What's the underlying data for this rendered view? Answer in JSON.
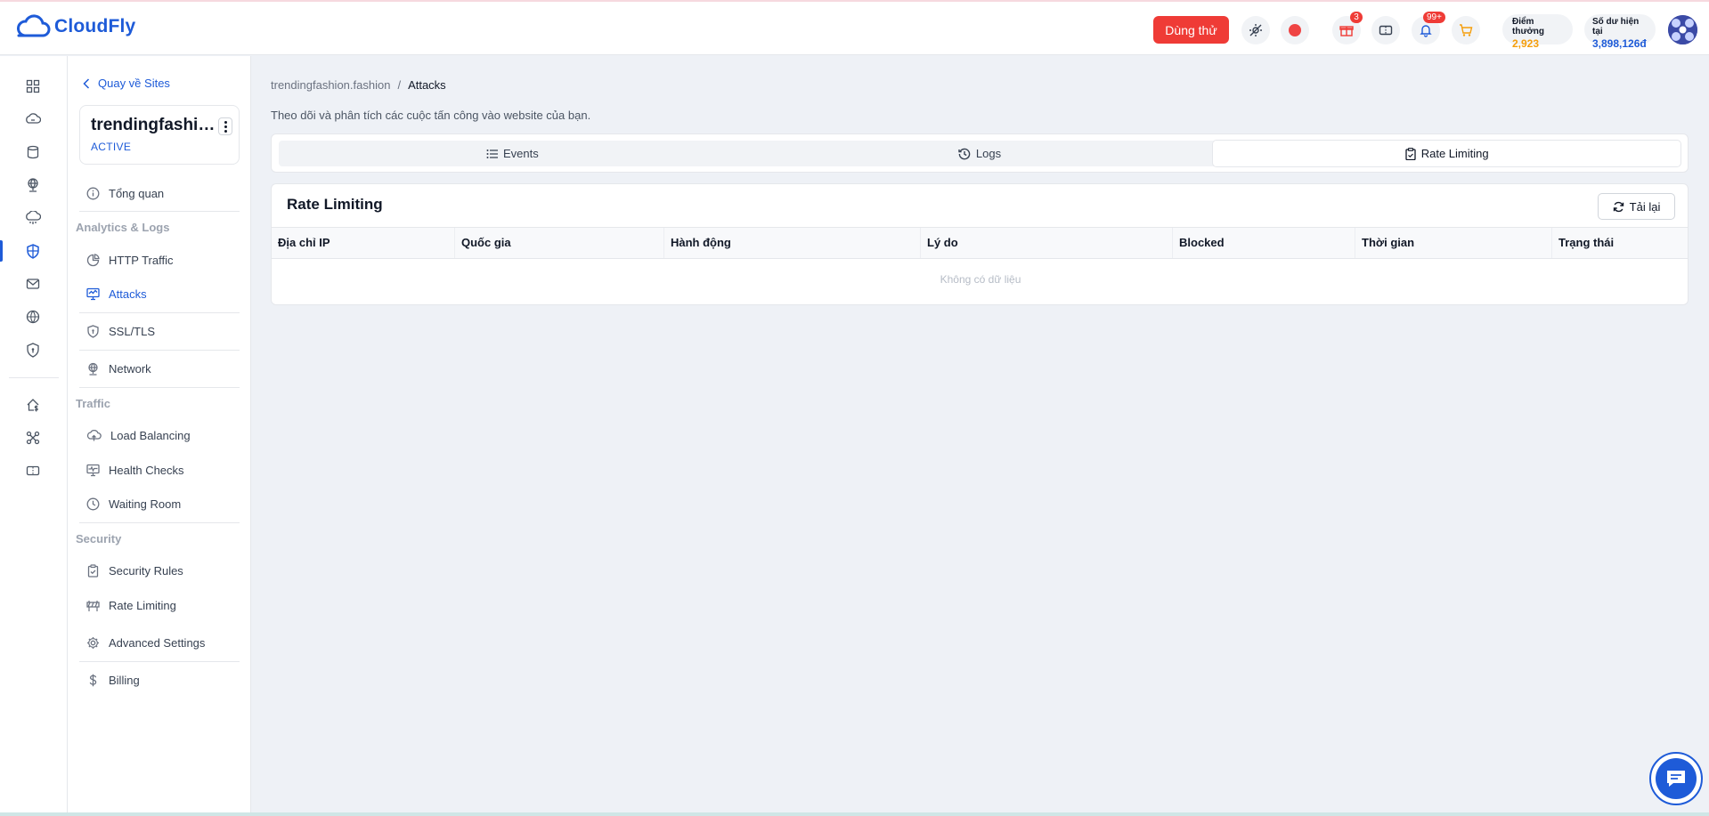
{
  "header": {
    "logo_text": "CloudFly",
    "trial_label": "Dùng thử",
    "gift_badge": "3",
    "notification_badge": "99+",
    "reward_label": "Điểm thưởng",
    "reward_value": "2,923",
    "balance_label": "Số dư hiện tại",
    "balance_value": "3,898,126đ",
    "colors": {
      "brand": "#1e5bd8",
      "trial": "#ef3b36",
      "reward": "#f59e0b"
    }
  },
  "rail": {
    "items": [
      "dashboard-icon",
      "cloud-server-icon",
      "database-icon",
      "network-globe-icon",
      "cloud-storage-icon",
      "cdn-shield-icon",
      "email-icon",
      "www-icon",
      "security-shield-icon",
      "home-dollar-icon",
      "integration-icon",
      "ticket-icon"
    ],
    "active_index": 5
  },
  "sidebar": {
    "back_label": "Quay về Sites",
    "site_name": "trendingfashion.fashion",
    "site_status": "ACTIVE",
    "overview_label": "Tổng quan",
    "groups": {
      "analytics": "Analytics & Logs",
      "traffic": "Traffic",
      "security": "Security"
    },
    "items": {
      "http_traffic": "HTTP Traffic",
      "attacks": "Attacks",
      "ssl": "SSL/TLS",
      "network": "Network",
      "load_balancing": "Load Balancing",
      "health_checks": "Health Checks",
      "waiting_room": "Waiting Room",
      "security_rules": "Security Rules",
      "rate_limiting": "Rate Limiting",
      "advanced_settings": "Advanced Settings",
      "billing": "Billing"
    }
  },
  "main": {
    "breadcrumb": {
      "site": "trendingfashion.fashion",
      "separator": "/",
      "current": "Attacks"
    },
    "subtitle": "Theo dõi và phân tích các cuộc tấn công vào website của bạn.",
    "tabs": [
      {
        "label": "Events",
        "icon": "list-icon"
      },
      {
        "label": "Logs",
        "icon": "history-icon"
      },
      {
        "label": "Rate Limiting",
        "icon": "clipboard-icon"
      }
    ],
    "active_tab": 2,
    "panel": {
      "title": "Rate Limiting",
      "reload_label": "Tải lại",
      "columns": [
        "Địa chỉ IP",
        "Quốc gia",
        "Hành động",
        "Lý do",
        "Blocked",
        "Thời gian",
        "Trạng thái"
      ],
      "rows": [],
      "empty_text": "Không có dữ liệu"
    }
  }
}
